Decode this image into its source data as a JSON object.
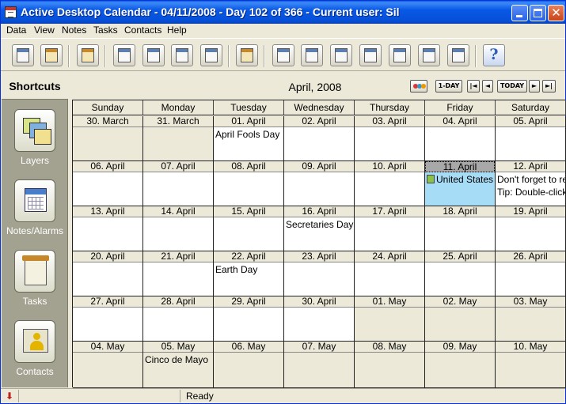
{
  "window": {
    "title": "Active Desktop Calendar - 04/11/2008 - Day 102 of 366 - Current user: Sil",
    "controls": {
      "minimize_icon": "minimize-icon",
      "maximize_icon": "maximize-icon",
      "close_label": "✕"
    }
  },
  "menu": [
    "Data",
    "View",
    "Notes",
    "Tasks",
    "Contacts",
    "Help"
  ],
  "toolbar": {
    "icons": [
      "calendar-layer-icon",
      "alarm-layer-icon",
      "print-icon",
      "edit-day-icon",
      "find-icon",
      "day-view-icon",
      "delete-day-icon",
      "new-note-icon",
      "move-note-icon",
      "check-task-icon",
      "raise-icon",
      "lower-icon",
      "bring-top-icon",
      "send-bottom-icon",
      "delete-note-icon",
      "help-icon"
    ],
    "help_label": "?"
  },
  "shortcuts": {
    "title": "Shortcuts",
    "items": [
      {
        "label": "Layers",
        "icon": "layers-icon"
      },
      {
        "label": "Notes/Alarms",
        "icon": "calendar-icon"
      },
      {
        "label": "Tasks",
        "icon": "clipboard-icon"
      },
      {
        "label": "Contacts",
        "icon": "contact-card-icon"
      }
    ]
  },
  "calendar": {
    "month_title": "April, 2008",
    "nav": {
      "one_day": "1-DAY",
      "first": "|◄",
      "prev": "◄",
      "today": "TODAY",
      "next": "►",
      "last": "►|"
    },
    "weekdays": [
      "Sunday",
      "Monday",
      "Tuesday",
      "Wednesday",
      "Thursday",
      "Friday",
      "Saturday"
    ],
    "weeks": [
      [
        {
          "label": "30. March",
          "other": true
        },
        {
          "label": "31. March",
          "other": true
        },
        {
          "label": "01. April",
          "events": [
            "April Fools Day"
          ]
        },
        {
          "label": "02. April"
        },
        {
          "label": "03. April"
        },
        {
          "label": "04. April"
        },
        {
          "label": "05. April"
        }
      ],
      [
        {
          "label": "06. April"
        },
        {
          "label": "07. April"
        },
        {
          "label": "08. April"
        },
        {
          "label": "09. April"
        },
        {
          "label": "10. April"
        },
        {
          "label": "11. April",
          "today": true,
          "events": [
            "United States H"
          ],
          "flag": true
        },
        {
          "label": "12. April",
          "events": [
            "Don't forget to reg",
            "Tip: Double-click h"
          ]
        }
      ],
      [
        {
          "label": "13. April"
        },
        {
          "label": "14. April"
        },
        {
          "label": "15. April"
        },
        {
          "label": "16. April",
          "events": [
            "Secretaries Day"
          ]
        },
        {
          "label": "17. April"
        },
        {
          "label": "18. April"
        },
        {
          "label": "19. April"
        }
      ],
      [
        {
          "label": "20. April"
        },
        {
          "label": "21. April"
        },
        {
          "label": "22. April",
          "events": [
            "Earth Day"
          ]
        },
        {
          "label": "23. April"
        },
        {
          "label": "24. April"
        },
        {
          "label": "25. April"
        },
        {
          "label": "26. April"
        }
      ],
      [
        {
          "label": "27. April"
        },
        {
          "label": "28. April"
        },
        {
          "label": "29. April"
        },
        {
          "label": "30. April"
        },
        {
          "label": "01. May",
          "other": true
        },
        {
          "label": "02. May",
          "other": true
        },
        {
          "label": "03. May",
          "other": true
        }
      ],
      [
        {
          "label": "04. May",
          "other": true
        },
        {
          "label": "05. May",
          "other": true,
          "events": [
            "Cinco de Mayo"
          ]
        },
        {
          "label": "06. May",
          "other": true
        },
        {
          "label": "07. May",
          "other": true
        },
        {
          "label": "08. May",
          "other": true
        },
        {
          "label": "09. May",
          "other": true
        },
        {
          "label": "10. May",
          "other": true
        }
      ]
    ]
  },
  "status": {
    "text": "Ready",
    "icon": "download-arrow-icon",
    "icon_glyph": "⬇"
  },
  "colors": {
    "title_bar": "#0958e6",
    "today_cell": "#a6dcf5",
    "panel": "#a3a290",
    "chrome": "#ece9d8"
  }
}
